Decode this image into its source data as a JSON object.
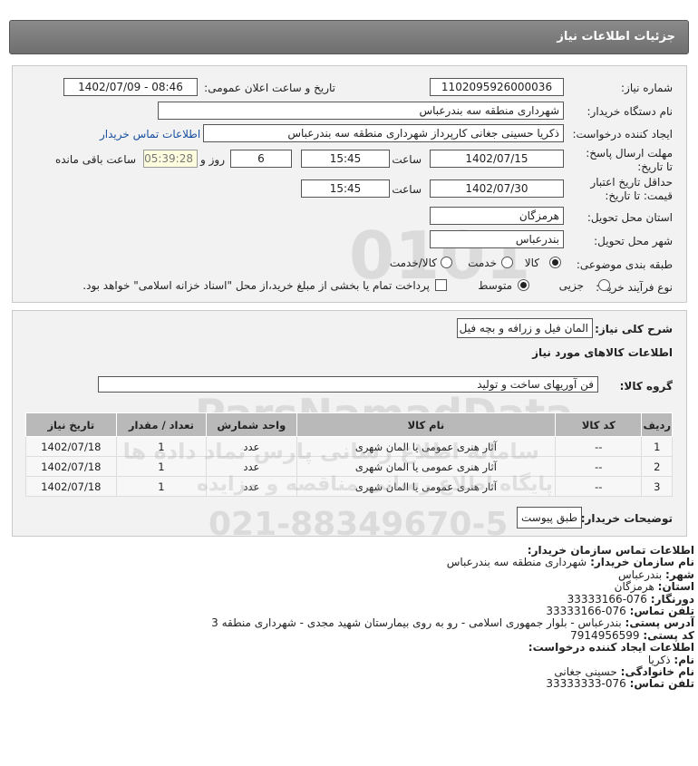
{
  "header": {
    "title": "جزئیات اطلاعات نیاز"
  },
  "form": {
    "need_number_label": "شماره نیاز:",
    "need_number": "1102095926000036",
    "announce_label": "تاریخ و ساعت اعلان عمومی:",
    "announce_value": "1402/07/09 - 08:46",
    "buyer_org_label": "نام دستگاه خریدار:",
    "buyer_org": "شهرداری منطقه سه بندرعباس",
    "creator_label": "ایجاد کننده درخواست:",
    "creator": "ذکریا حسینی جغانی کارپرداز شهرداری منطقه سه بندرعباس",
    "contact_link": "اطلاعات تماس خریدار",
    "deadline_label": "مهلت ارسال پاسخ: تا تاریخ:",
    "deadline_date": "1402/07/15",
    "time_label": "ساعت",
    "deadline_time": "15:45",
    "days_value": "6",
    "days_label": "روز و",
    "remaining_time": "05:39:28",
    "remaining_label": "ساعت باقی مانده",
    "validity_label": "حداقل تاریخ اعتبار قیمت: تا تاریخ:",
    "validity_date": "1402/07/30",
    "validity_time": "15:45",
    "province_label": "استان محل تحویل:",
    "province": "هرمزگان",
    "city_label": "شهر محل تحویل:",
    "city": "بندرعباس",
    "category_label": "طبقه بندی موضوعی:",
    "category_options": [
      "کالا",
      "خدمت",
      "کالا/خدمت"
    ],
    "purchase_label": "نوع فرآیند خرید :",
    "purchase_options": [
      "جزیی",
      "متوسط"
    ],
    "purchase_note": "پرداخت تمام یا بخشی از مبلغ خرید،از محل \"اسناد خزانه اسلامی\" خواهد بود."
  },
  "summary": {
    "label": "شرح کلی نیاز:",
    "value": "المان فیل و زرافه و بچه فیل",
    "goods_info_title": "اطلاعات کالاهای مورد نیاز",
    "goods_group_label": "گروه کالا:",
    "goods_group": "فن آوریهای ساخت و تولید"
  },
  "table": {
    "headers": [
      "ردیف",
      "کد کالا",
      "نام کالا",
      "واحد شمارش",
      "تعداد / مقدار",
      "تاریخ نیاز"
    ],
    "rows": [
      [
        "1",
        "--",
        "آثار هنری عمومی یا المان شهری",
        "عدد",
        "1",
        "1402/07/18"
      ],
      [
        "2",
        "--",
        "آثار هنری عمومی یا المان شهری",
        "عدد",
        "1",
        "1402/07/18"
      ],
      [
        "3",
        "--",
        "آثار هنری عمومی یا المان شهری",
        "عدد",
        "1",
        "1402/07/18"
      ]
    ]
  },
  "buyer_notes": {
    "label": "توضیحات خریدار:",
    "value": "طبق پیوست"
  },
  "contact": {
    "title": "اطلاعات تماس سازمان خریدار:",
    "org_label": "نام سازمان خریدار:",
    "org": "شهرداری منطقه سه بندرعباس",
    "city_label": "شهر:",
    "city": "بندرعباس",
    "province_label": "استان:",
    "province": "هرمزگان",
    "fax_label": "دورنگار:",
    "fax": "076-33333166",
    "phone_label": "تلفن تماس:",
    "phone": "076-33333166",
    "address_label": "آدرس پستی:",
    "address": "بندرعباس - بلوار جمهوری اسلامی - رو به روی بیمارستان شهید مجدی - شهرداری منطقه 3",
    "postal_label": "کد پستی:",
    "postal": "7914956599",
    "creator_title": "اطلاعات ایجاد کننده درخواست:",
    "first_name_label": "نام:",
    "first_name": "ذکریا",
    "last_name_label": "نام خانوادگی:",
    "last_name": "حسینی جغانی",
    "creator_phone_label": "تلفن تماس:",
    "creator_phone": "076-33333333"
  },
  "watermark": {
    "brand": "ParsNamadData",
    "line1": "سامانه اطلاع رسانی پارس نماد داده ها",
    "line2": "پایگاه اطلاع رسانی مناقصه و مزایده",
    "phone": "021-88349670-5",
    "digits": "0101"
  }
}
